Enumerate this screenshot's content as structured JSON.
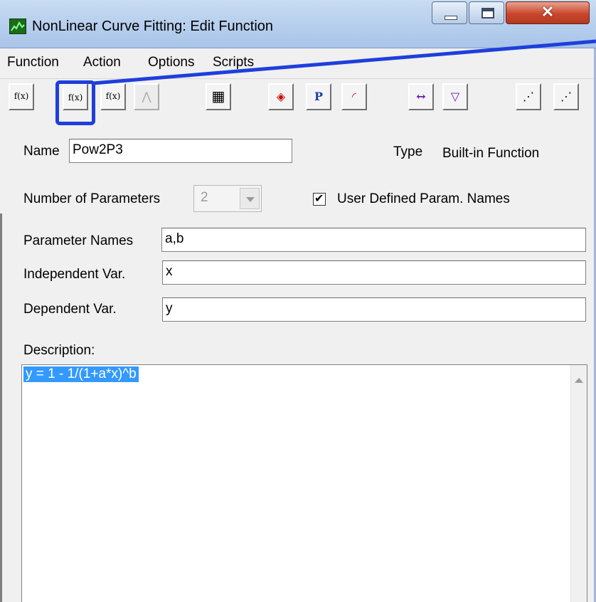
{
  "window": {
    "title": "NonLinear Curve Fitting:  Edit Function",
    "close_glyph": "✕"
  },
  "menu": [
    "Function",
    "Action",
    "Options",
    "Scripts"
  ],
  "toolbar": {
    "buttons": [
      {
        "name": "check-function-icon",
        "glyph": "f(x)"
      },
      {
        "name": "edit-function-icon",
        "glyph": "f(x)"
      },
      {
        "name": "function-dialog-icon",
        "glyph": "f(x)"
      },
      {
        "name": "peak-icon",
        "glyph": "⋀"
      },
      {
        "name": "table-icon",
        "glyph": "▦"
      },
      {
        "name": "traffic-light-icon",
        "glyph": "◈"
      },
      {
        "name": "param-p-icon",
        "glyph": "P"
      },
      {
        "name": "curve-fit-icon",
        "glyph": "◜"
      },
      {
        "name": "range-icon",
        "glyph": "↔"
      },
      {
        "name": "param-filter-icon",
        "glyph": "▽"
      },
      {
        "name": "step-back-icon",
        "glyph": "⋰"
      },
      {
        "name": "step-forward-icon",
        "glyph": "⋰"
      }
    ],
    "highlight_color": "#1e3fdc"
  },
  "form": {
    "name_label": "Name",
    "name_value": "Pow2P3",
    "type_label": "Type",
    "type_value": "Built-in Function",
    "num_params_label": "Number of Parameters",
    "num_params_value": "2",
    "user_defined_label": "User Defined Param. Names",
    "user_defined_checked": true,
    "param_names_label": "Parameter Names",
    "param_names_value": "a,b",
    "independent_label": "Independent Var.",
    "independent_value": "x",
    "dependent_label": "Dependent Var.",
    "dependent_value": "y",
    "description_label": "Description:",
    "description_value": "y = 1 - 1/(1+a*x)^b"
  }
}
